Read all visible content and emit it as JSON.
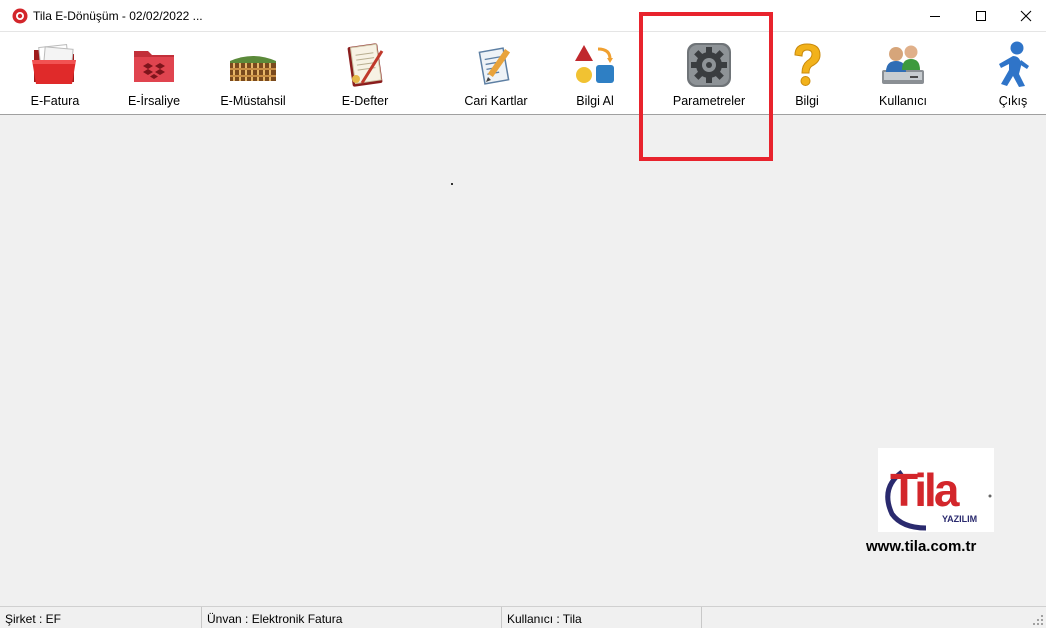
{
  "window": {
    "title": "Tila E-Dönüşüm - 02/02/2022 ..."
  },
  "toolbar": {
    "items": [
      {
        "label": "E-Fatura",
        "icon": "red-folder-icon"
      },
      {
        "label": "E-İrsaliye",
        "icon": "dropbox-folder-icon"
      },
      {
        "label": "E-Müstahsil",
        "icon": "farm-field-icon"
      },
      {
        "label": "E-Defter",
        "icon": "ledger-book-icon"
      },
      {
        "label": "Cari Kartlar",
        "icon": "clipboard-pen-icon"
      },
      {
        "label": "Bilgi Al",
        "icon": "shapes-icon"
      },
      {
        "label": "Parametreler",
        "icon": "gear-icon"
      },
      {
        "label": "Bilgi",
        "icon": "question-icon"
      },
      {
        "label": "Kullanıcı",
        "icon": "users-icon"
      },
      {
        "label": "Çıkış",
        "icon": "running-man-icon"
      }
    ]
  },
  "logo": {
    "brand": "Tila",
    "sub": "YAZILIM",
    "url": "www.tila.com.tr"
  },
  "statusbar": {
    "company": "Şirket : EF",
    "title": "Ünvan : Elektronik Fatura",
    "user": "Kullanıcı : Tila"
  },
  "colors": {
    "highlight": "#e8232d",
    "brand_red": "#d3262b",
    "brand_navy": "#2a2a6e"
  }
}
